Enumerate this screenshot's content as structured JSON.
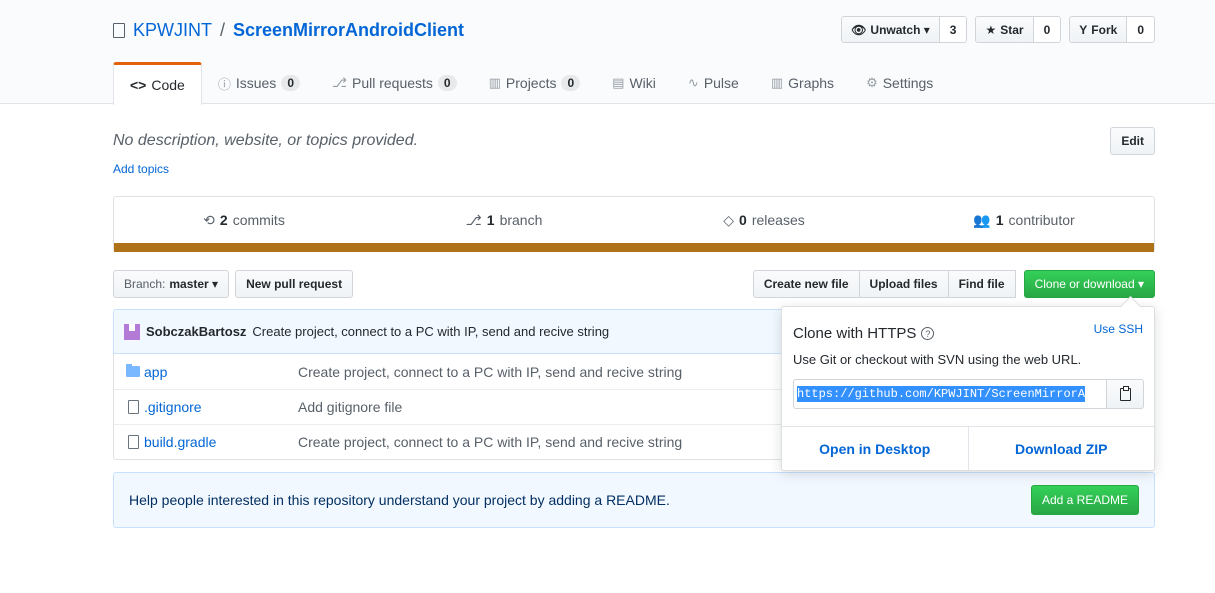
{
  "repo": {
    "owner": "KPWJINT",
    "separator": "/",
    "name": "ScreenMirrorAndroidClient"
  },
  "actions": {
    "watch": {
      "label": "Unwatch ▾",
      "count": "3"
    },
    "star": {
      "label": "Star",
      "count": "0"
    },
    "fork": {
      "label": "Fork",
      "count": "0"
    }
  },
  "tabs": [
    {
      "icon": "<>",
      "label": "Code"
    },
    {
      "icon": "ⓘ",
      "label": "Issues",
      "count": "0"
    },
    {
      "icon": "⎇",
      "label": "Pull requests",
      "count": "0"
    },
    {
      "icon": "▥",
      "label": "Projects",
      "count": "0"
    },
    {
      "icon": "▤",
      "label": "Wiki"
    },
    {
      "icon": "∿",
      "label": "Pulse"
    },
    {
      "icon": "▥",
      "label": "Graphs"
    },
    {
      "icon": "⚙",
      "label": "Settings"
    }
  ],
  "description": "No description, website, or topics provided.",
  "add_topics": "Add topics",
  "edit_label": "Edit",
  "summary": {
    "commits_count": "2",
    "commits_label": "commits",
    "branch_count": "1",
    "branch_label": "branch",
    "releases_count": "0",
    "releases_label": "releases",
    "contributor_count": "1",
    "contributor_label": "contributor",
    "language_color": "#b07219"
  },
  "file_nav": {
    "branch_prefix": "Branch:",
    "branch_name": "master ▾",
    "new_pr": "New pull request",
    "create_file": "Create new file",
    "upload_files": "Upload files",
    "find_file": "Find file",
    "clone_download": "Clone or download ▾"
  },
  "commit": {
    "author": "SobczakBartosz",
    "message": "Create project, connect to a PC with IP, send and recive string"
  },
  "files": [
    {
      "type": "folder",
      "name": "app",
      "message": "Create project, connect to a PC with IP, send and recive string"
    },
    {
      "type": "file",
      "name": ".gitignore",
      "message": "Add gitignore file"
    },
    {
      "type": "file",
      "name": "build.gradle",
      "message": "Create project, connect to a PC with IP, send and recive string"
    }
  ],
  "readme": {
    "text": "Help people interested in this repository understand your project by adding a README.",
    "button": "Add a README"
  },
  "clone": {
    "title": "Clone with HTTPS",
    "help": "?",
    "use_ssh": "Use SSH",
    "subtitle": "Use Git or checkout with SVN using the web URL.",
    "url": "https://github.com/KPWJINT/ScreenMirrorA",
    "open_desktop": "Open in Desktop",
    "download_zip": "Download ZIP"
  }
}
